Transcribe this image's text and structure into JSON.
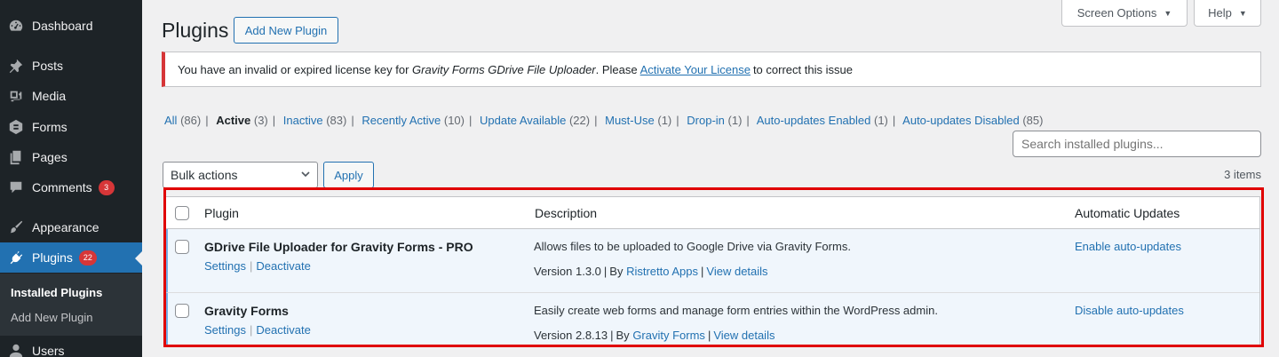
{
  "menu": {
    "dashboard": "Dashboard",
    "posts": "Posts",
    "media": "Media",
    "forms": "Forms",
    "pages": "Pages",
    "comments": "Comments",
    "comments_count": "3",
    "appearance": "Appearance",
    "plugins": "Plugins",
    "plugins_count": "22",
    "users": "Users",
    "installed": "Installed Plugins",
    "add_new": "Add New Plugin"
  },
  "header": {
    "title": "Plugins",
    "add_new": "Add New Plugin",
    "screen_options": "Screen Options",
    "help": "Help"
  },
  "notice": {
    "pre": "You have an invalid or expired license key for",
    "product": "Gravity Forms GDrive File Uploader",
    "mid": ". Please",
    "link": "Activate Your License",
    "post": "to correct this issue"
  },
  "filters": [
    {
      "label": "All",
      "count": "(86)"
    },
    {
      "label": "Active",
      "count": "(3)"
    },
    {
      "label": "Inactive",
      "count": "(83)"
    },
    {
      "label": "Recently Active",
      "count": "(10)"
    },
    {
      "label": "Update Available",
      "count": "(22)"
    },
    {
      "label": "Must-Use",
      "count": "(1)"
    },
    {
      "label": "Drop-in",
      "count": "(1)"
    },
    {
      "label": "Auto-updates Enabled",
      "count": "(1)"
    },
    {
      "label": "Auto-updates Disabled",
      "count": "(85)"
    }
  ],
  "search_placeholder": "Search installed plugins...",
  "bulk": {
    "selected": "Bulk actions",
    "apply": "Apply"
  },
  "items_count": "3 items",
  "table": {
    "headers": {
      "plugin": "Plugin",
      "description": "Description",
      "auto": "Automatic Updates"
    },
    "rows": [
      {
        "name": "GDrive File Uploader for Gravity Forms - PRO",
        "settings": "Settings",
        "deactivate": "Deactivate",
        "description": "Allows files to be uploaded to Google Drive via Gravity Forms.",
        "version": "Version 1.3.0",
        "by": "By",
        "author": "Ristretto Apps",
        "details": "View details",
        "auto": "Enable auto-updates"
      },
      {
        "name": "Gravity Forms",
        "settings": "Settings",
        "deactivate": "Deactivate",
        "description": "Easily create web forms and manage form entries within the WordPress admin.",
        "version": "Version 2.8.13",
        "by": "By",
        "author": "Gravity Forms",
        "details": "View details",
        "auto": "Disable auto-updates"
      }
    ]
  },
  "colors": {
    "highlight": "#e00000",
    "accent": "#2271b1",
    "sidebar": "#1d2327"
  }
}
